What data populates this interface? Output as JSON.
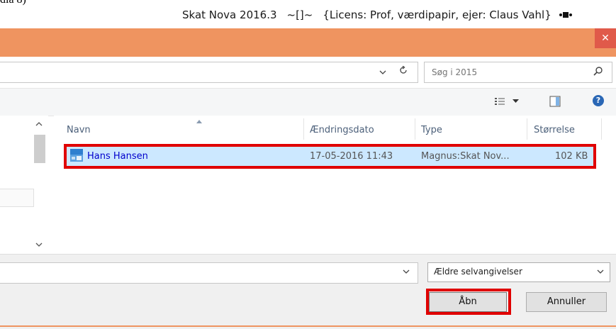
{
  "window": {
    "top_fragment": "dia 8)",
    "app_name": "Skat Nova 2016.3",
    "title_sep": "~[]~",
    "license": "{Licens: Prof, værdipapir, ejer: Claus Vahl}",
    "close_symbol": "✕"
  },
  "search": {
    "placeholder": "Søg i 2015"
  },
  "toolbar": {
    "help_symbol": "?"
  },
  "file_list": {
    "columns": [
      "Navn",
      "Ændringsdato",
      "Type",
      "Størrelse"
    ],
    "rows": [
      {
        "name": "Hans Hansen",
        "date": "17-05-2016 11:43",
        "type": "Magnus:Skat Nov...",
        "size": "102 KB"
      }
    ]
  },
  "footer": {
    "file_type": "Ældre selvangivelser",
    "open_label": "Åbn",
    "cancel_label": "Annuller"
  },
  "colors": {
    "title_bar": "#ef9460",
    "close_button": "#e05a4a",
    "selection": "#cce8ff",
    "highlight": "#e00000",
    "file_name": "#0000cc"
  },
  "icons": [
    "close-icon",
    "chevron-down-icon",
    "refresh-icon",
    "search-icon",
    "view-options-icon",
    "preview-pane-icon",
    "help-icon",
    "file-icon"
  ]
}
